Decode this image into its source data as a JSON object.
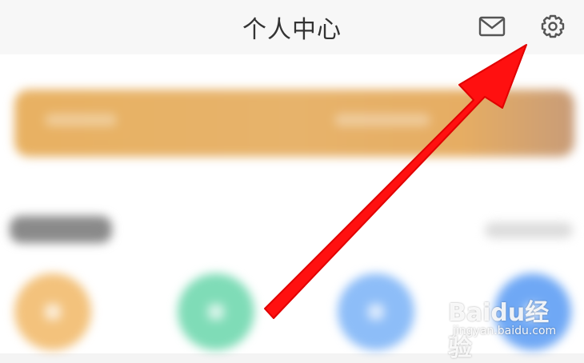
{
  "header": {
    "title": "个人中心",
    "mail_icon": "envelope-icon",
    "settings_icon": "gear-icon"
  },
  "content": {
    "banner": {
      "color": "#e8b162",
      "blurred": true
    },
    "section": {
      "blurred": true
    },
    "shortcuts": [
      {
        "icon": "orange-circle-icon",
        "color": "#f3c27c"
      },
      {
        "icon": "green-circle-icon",
        "color": "#7fdcb7"
      },
      {
        "icon": "blue-circle-icon",
        "color": "#8dbdf8"
      },
      {
        "icon": "blue-circle-icon",
        "color": "#6fa8f5"
      }
    ]
  },
  "annotation": {
    "type": "red-arrow",
    "target": "settings-button",
    "color": "#ff1010"
  },
  "watermark": {
    "logo": "Baidu经验",
    "url": "jingyan.baidu.com"
  }
}
